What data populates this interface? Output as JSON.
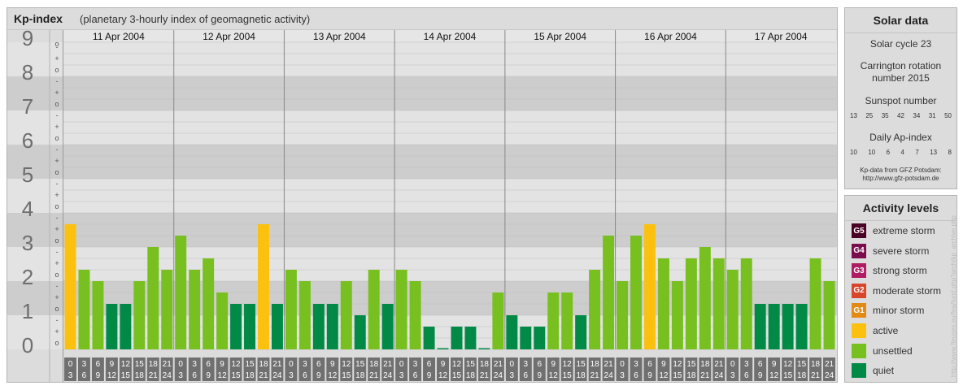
{
  "header": {
    "title": "Kp-index",
    "subtitle": "(planetary 3-hourly index of geomagnetic activity)"
  },
  "colors": {
    "quiet": "#008a46",
    "unsettled": "#78c01f",
    "active": "#fcc10f",
    "g1": "#e38a16",
    "g2": "#d8452b",
    "g3": "#b01c63",
    "g4": "#7a0d4e",
    "g5": "#4a0024"
  },
  "chart_data": {
    "type": "bar",
    "title": "Kp-index",
    "subtitle": "(planetary 3-hourly index of geomagnetic activity)",
    "ylim": [
      0,
      9
    ],
    "y_ticks": [
      "0",
      "1",
      "2",
      "3",
      "4",
      "5",
      "6",
      "7",
      "8",
      "9"
    ],
    "minor_tick_marks": [
      "o",
      "+",
      "-"
    ],
    "dates": [
      "11 Apr 2004",
      "12 Apr 2004",
      "13 Apr 2004",
      "14 Apr 2004",
      "15 Apr 2004",
      "16 Apr 2004",
      "17 Apr 2004"
    ],
    "intervals": [
      [
        "0",
        "3"
      ],
      [
        "3",
        "6"
      ],
      [
        "6",
        "9"
      ],
      [
        "9",
        "12"
      ],
      [
        "12",
        "15"
      ],
      [
        "15",
        "18"
      ],
      [
        "18",
        "21"
      ],
      [
        "21",
        "24"
      ]
    ],
    "values": [
      [
        3.667,
        2.333,
        2.0,
        1.333,
        1.333,
        2.0,
        3.0,
        2.333
      ],
      [
        3.333,
        2.333,
        2.667,
        1.667,
        1.333,
        1.333,
        3.667,
        1.333
      ],
      [
        2.333,
        2.0,
        1.333,
        1.333,
        2.0,
        1.0,
        2.333,
        1.333
      ],
      [
        2.333,
        2.0,
        0.667,
        0.0,
        0.667,
        0.667,
        0.0,
        1.667
      ],
      [
        1.0,
        0.667,
        0.667,
        1.667,
        1.667,
        1.0,
        2.333,
        3.333
      ],
      [
        2.0,
        3.333,
        3.667,
        2.667,
        2.0,
        2.667,
        3.0,
        2.667
      ],
      [
        2.333,
        2.667,
        1.333,
        1.333,
        1.333,
        1.333,
        2.667,
        2.0
      ]
    ],
    "grid": true
  },
  "solar": {
    "title": "Solar data",
    "cycle": "Solar cycle 23",
    "carrington": "Carrington rotation number 2015",
    "sunspot_label": "Sunspot number",
    "sunspot_values": [
      "13",
      "25",
      "35",
      "42",
      "34",
      "31",
      "50"
    ],
    "ap_label": "Daily Ap-index",
    "ap_values": [
      "10",
      "10",
      "6",
      "4",
      "7",
      "13",
      "8"
    ],
    "credit_line1": "Kp-data from GFZ Potsdam:",
    "credit_line2": "http://www.gfz-potsdam.de"
  },
  "levels": {
    "title": "Activity levels",
    "items": [
      {
        "badge": "G5",
        "label": "extreme storm",
        "color": "#4a0024"
      },
      {
        "badge": "G4",
        "label": "severe storm",
        "color": "#7a0d4e"
      },
      {
        "badge": "G3",
        "label": "strong storm",
        "color": "#b01c63"
      },
      {
        "badge": "G2",
        "label": "moderate storm",
        "color": "#d8452b"
      },
      {
        "badge": "G1",
        "label": "minor storm",
        "color": "#e38a16"
      },
      {
        "badge": "",
        "label": "active",
        "color": "#fcc10f"
      },
      {
        "badge": "",
        "label": "unsettled",
        "color": "#78c01f"
      },
      {
        "badge": "",
        "label": "quiet",
        "color": "#008a46"
      }
    ]
  },
  "side_url": "http://www.fleuses.eu/fea/fund.php?arch/kp_archive.php"
}
